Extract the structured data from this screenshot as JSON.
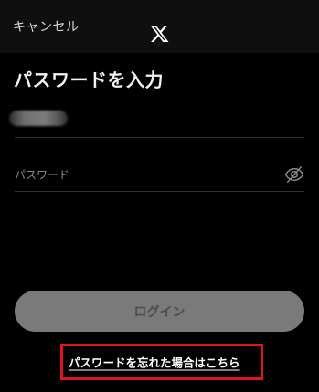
{
  "header": {
    "cancel_label": "キャンセル",
    "logo_icon": "x-logo-icon"
  },
  "page": {
    "title": "パスワードを入力"
  },
  "form": {
    "username_value": "",
    "password_placeholder": "パスワード",
    "visibility_icon": "eye-slash-icon"
  },
  "actions": {
    "login_label": "ログイン",
    "forgot_password_label": "パスワードを忘れた場合はこちら"
  },
  "colors": {
    "background": "#000000",
    "login_button": "#7a7a7a",
    "highlight_box": "#e0141b"
  }
}
